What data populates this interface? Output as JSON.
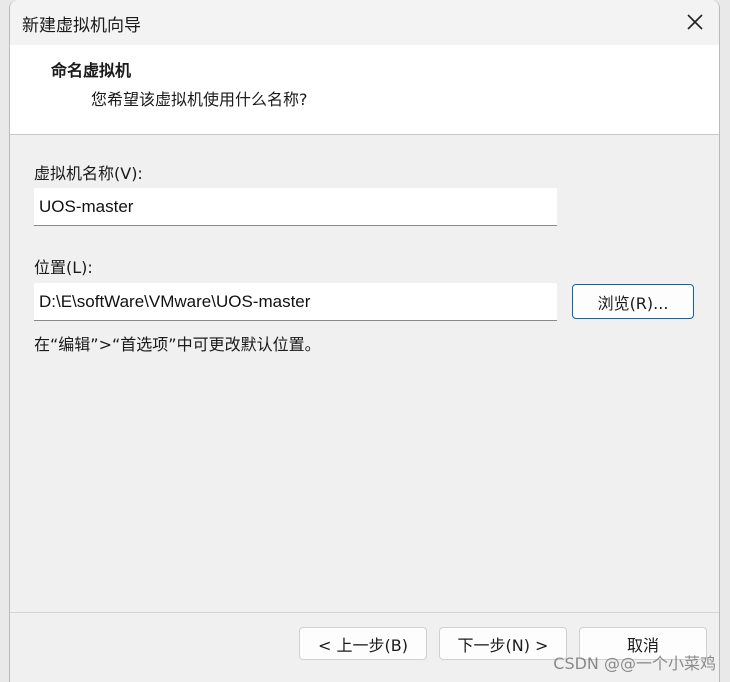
{
  "window": {
    "title": "新建虚拟机向导"
  },
  "header": {
    "title": "命名虚拟机",
    "subtitle": "您希望该虚拟机使用什么名称?"
  },
  "form": {
    "name_label": "虚拟机名称(V):",
    "name_value": "UOS-master",
    "location_label": "位置(L):",
    "location_value": "D:\\E\\softWare\\VMware\\UOS-master",
    "browse_label": "浏览(R)...",
    "hint": "在“编辑”>“首选项”中可更改默认位置。"
  },
  "footer": {
    "back_label": "< 上一步(B)",
    "next_label": "下一步(N) >",
    "cancel_label": "取消"
  },
  "watermark": "CSDN @@一个小菜鸡",
  "icons": {
    "close": "close-icon"
  },
  "colors": {
    "accent": "#0a64b4",
    "header_bg": "#ffffff",
    "body_bg": "#f0f0f0"
  }
}
